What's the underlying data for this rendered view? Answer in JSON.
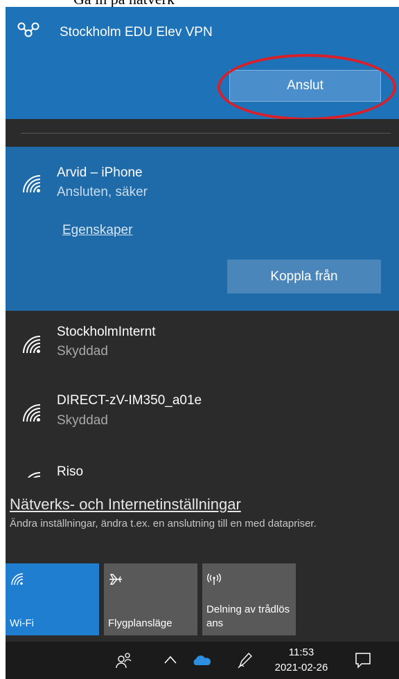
{
  "caption": "Gå in på nätverk",
  "vpn": {
    "name": "Stockholm EDU Elev VPN",
    "connect_label": "Anslut"
  },
  "active_network": {
    "name": "Arvid – iPhone",
    "status": "Ansluten, säker",
    "properties_link": "Egenskaper",
    "disconnect_label": "Koppla från"
  },
  "networks": [
    {
      "name": "StockholmInternt",
      "status": "Skyddad"
    },
    {
      "name": "DIRECT-zV-IM350_a01e",
      "status": "Skyddad"
    },
    {
      "name": "Riso"
    }
  ],
  "settings": {
    "link": "Nätverks- och Internetinställningar",
    "description": "Ändra inställningar, ändra t.ex. en anslutning till en med datapriser."
  },
  "quick_actions": [
    {
      "label": "Wi-Fi",
      "icon": "wifi-icon",
      "active": true
    },
    {
      "label": "Flygplansläge",
      "icon": "airplane-icon",
      "active": false
    },
    {
      "label": "Delning av trådlös ans",
      "icon": "hotspot-icon",
      "active": false
    }
  ],
  "taskbar": {
    "time": "11:53",
    "date": "2021-02-26"
  },
  "colors": {
    "vpn_bg": "#1e73b8",
    "active_bg": "#1f6aa8",
    "flyout_bg": "#2b2b2b",
    "tile_active": "#1f7ed0",
    "tile_inactive": "#595959",
    "highlight_circle": "#d81f2a"
  }
}
